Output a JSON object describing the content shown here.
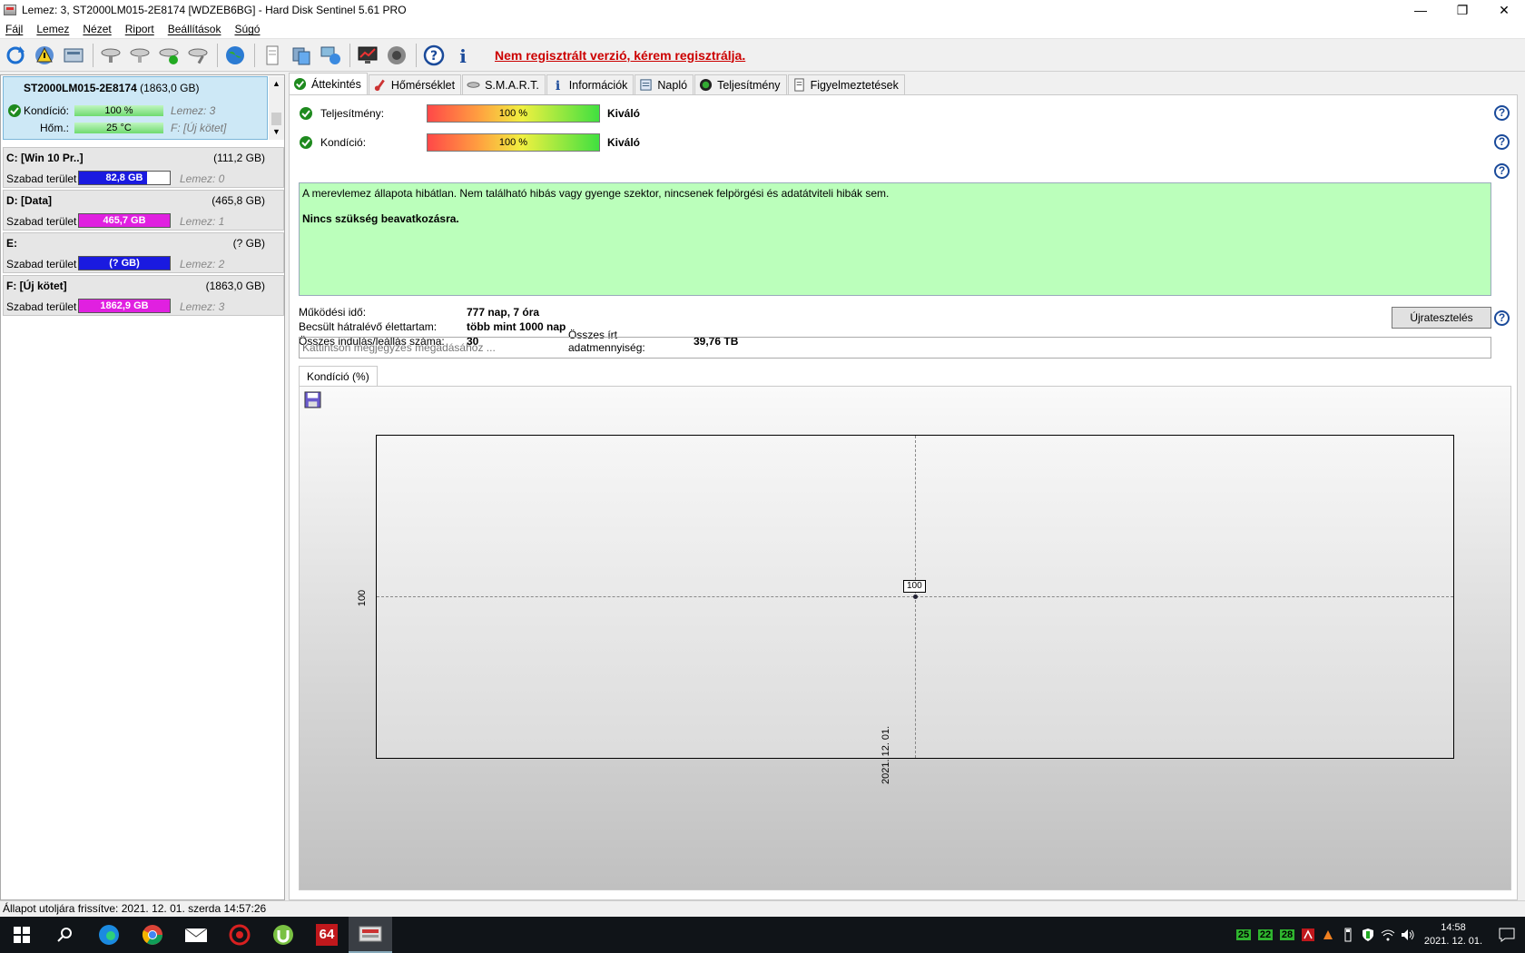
{
  "window": {
    "title": "Lemez: 3, ST2000LM015-2E8174 [WDZEB6BG]  -  Hard Disk Sentinel 5.61 PRO",
    "controls": [
      "—",
      "❐",
      "✕"
    ]
  },
  "menu": [
    "Fájl",
    "Lemez",
    "Nézet",
    "Riport",
    "Beállítások",
    "Súgó"
  ],
  "toolbar": {
    "icons": [
      "refresh-icon",
      "warning-disk-icon",
      "disk-info-icon",
      "disk-test-icon",
      "disk-test-2-icon",
      "disk-ok-icon",
      "disk-tool-icon",
      "globe-icon",
      "report-icon",
      "transfer-icon",
      "network-icon",
      "monitor-icon",
      "speaker-icon",
      "help-icon",
      "info-icon"
    ],
    "register_text": "Nem regisztrált verzió, kérem regisztrálja."
  },
  "disk": {
    "name": "ST2000LM015-2E8174",
    "size": "(1863,0 GB)",
    "condition_label": "Kondíció:",
    "condition_value": "100 %",
    "condition_extra": "Lemez: 3",
    "temp_label": "Hőm.:",
    "temp_value": "25 °C",
    "temp_extra": "F: [Új kötet]"
  },
  "partitions": [
    {
      "name": "C: [Win 10 Pr..]",
      "size": "(111,2 GB)",
      "label": "Szabad terület",
      "free": "82,8 GB",
      "disk": "Lemez: 0",
      "color": "#1a1ae0",
      "fill": 0.745
    },
    {
      "name": "D: [Data]",
      "size": "(465,8 GB)",
      "label": "Szabad terület",
      "free": "465,7 GB",
      "disk": "Lemez: 1",
      "color": "#e020e0",
      "fill": 1.0
    },
    {
      "name": "E:",
      "size": "(? GB)",
      "label": "Szabad terület",
      "free": "(? GB)",
      "disk": "Lemez: 2",
      "color": "#1a1ae0",
      "fill": 1.0
    },
    {
      "name": "F: [Új kötet]",
      "size": "(1863,0 GB)",
      "label": "Szabad terület",
      "free": "1862,9 GB",
      "disk": "Lemez: 3",
      "color": "#e020e0",
      "fill": 1.0
    }
  ],
  "tabs": [
    "Áttekintés",
    "Hőmérséklet",
    "S.M.A.R.T.",
    "Információk",
    "Napló",
    "Teljesítmény",
    "Figyelmeztetések"
  ],
  "overview": {
    "performance_label": "Teljesítmény:",
    "performance_value": "100 %",
    "performance_level": 1.0,
    "performance_verdict": "Kiváló",
    "condition_label": "Kondíció:",
    "condition_value": "100 %",
    "condition_level": 1.0,
    "condition_verdict": "Kiváló",
    "message": "A merevlemez állapota hibátlan. Nem található hibás vagy gyenge szektor, nincsenek felpörgési és adatátviteli hibák sem.",
    "message_strong": "Nincs szükség beavatkozásra.",
    "uptime_label": "Működési idő:",
    "uptime_value": "777 nap, 7 óra",
    "lifetime_label": "Becsült hátralévő élettartam:",
    "lifetime_value": "több mint 1000 nap",
    "starts_label": "Összes indulás/leállás száma:",
    "starts_value": "30",
    "written_label": "Összes írt adatmennyiség:",
    "written_value": "39,76 TB",
    "retest_button": "Újratesztelés",
    "note_placeholder": "Kattintson megjegyzés megadásához ..."
  },
  "graph_tab": "Kondíció  (%)",
  "chart_data": {
    "type": "line",
    "x": [
      "2021. 12. 01."
    ],
    "series": [
      {
        "values": [
          100
        ]
      }
    ],
    "yticks": [
      "100"
    ],
    "point_label": "100"
  },
  "statusbar": "Állapot utoljára frissítve: 2021. 12. 01. szerda 14:57:26",
  "taskbar": {
    "apps": [
      "windows-start-icon",
      "search-icon",
      "edge-icon",
      "chrome-icon",
      "mail-icon",
      "game-icon",
      "utorrent-icon",
      "aida64-icon",
      "hdsentinel-icon"
    ],
    "aida_label": "64",
    "temps": [
      "25",
      "22",
      "28"
    ],
    "time": "14:58",
    "date": "2021. 12. 01."
  }
}
